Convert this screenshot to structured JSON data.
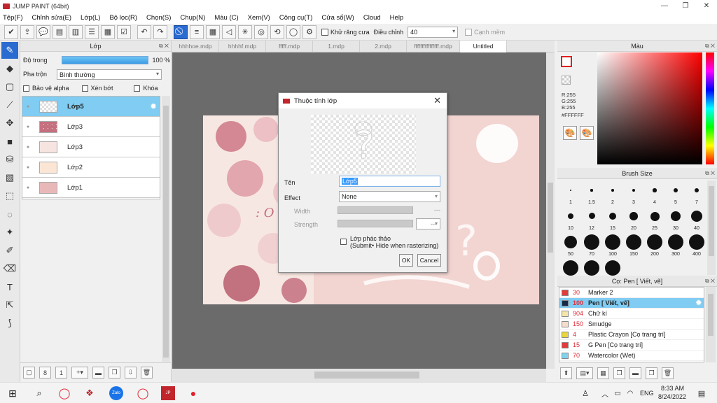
{
  "window": {
    "title": "JUMP PAINT (64bit)",
    "minimize": "—",
    "maximize": "❐",
    "close": "✕"
  },
  "menu": [
    "Tệp(F)",
    "Chỉnh sửa(E)",
    "Lớp(L)",
    "Bộ lọc(R)",
    "Chọn(S)",
    "Chụp(N)",
    "Màu (C)",
    "Xem(V)",
    "Công cụ(T)",
    "Cửa sổ(W)",
    "Cloud",
    "Help"
  ],
  "toolbar": {
    "antialias_label": "Khử răng cưa",
    "adjust_label": "Điều chỉnh",
    "adjust_value": "40",
    "sharp_label": "Cạnh mềm"
  },
  "layer_panel": {
    "title": "Lớp",
    "opacity_label": "Độ trong",
    "opacity_value": "100 %",
    "opacity_fraction": 1.0,
    "blend_label": "Pha trộn",
    "blend_value": "Bình thường",
    "protect_alpha": "Bảo vệ alpha",
    "clip": "Xén bớt",
    "lock": "Khóa",
    "layers": [
      {
        "name": "Lớp5",
        "selected": true
      },
      {
        "name": "Lớp3",
        "selected": false
      },
      {
        "name": "Lớp3",
        "selected": false
      },
      {
        "name": "Lớp2",
        "selected": false
      },
      {
        "name": "Lớp1",
        "selected": false
      }
    ]
  },
  "tabs": [
    "hhhhoe.mdp",
    "hhhhf.mdp",
    "fffff.mdp",
    "1.mdp",
    "2.mdp",
    "ffffffffffffffff.mdp",
    "Untitled"
  ],
  "active_tab": 6,
  "dialog": {
    "title": "Thuộc tính lớp",
    "name_label": "Tên",
    "name_value": "Lớp5",
    "effect_label": "Effect",
    "effect_value": "None",
    "width_label": "Width",
    "width_value": "---",
    "strength_label": "Strength",
    "strength_value": "---",
    "sketch_label": "Lớp phác thảo",
    "sketch_sub": "(Submit• Hide when rasterizing)",
    "ok": "OK",
    "cancel": "Cancel"
  },
  "color_panel": {
    "title": "Màu",
    "r": "R:255",
    "g": "G:255",
    "b": "B:255",
    "hex": "#FFFFFF"
  },
  "brush_panel": {
    "title": "Brush Size",
    "sizes": [
      "1",
      "1.5",
      "2",
      "3",
      "4",
      "5",
      "7",
      "10",
      "12",
      "15",
      "20",
      "25",
      "30",
      "40",
      "50",
      "70",
      "100",
      "150",
      "200",
      "300",
      "400",
      "",
      "",
      ""
    ]
  },
  "tool_panel": {
    "title": "Cọ: Pen [ Viết, vẽ]",
    "items": [
      {
        "num": "30",
        "name": "Marker 2",
        "color": "#e53a3a",
        "selected": false
      },
      {
        "num": "100",
        "name": "Pen [ Viết, vẽ]",
        "color": "#1b2a44",
        "selected": true
      },
      {
        "num": "904",
        "name": "Chữ kí",
        "color": "#f3e6a8",
        "selected": false
      },
      {
        "num": "150",
        "name": "Smudge",
        "color": "#f5dccc",
        "selected": false
      },
      {
        "num": "4",
        "name": "Plastic Crayon [Cọ trang trí]",
        "color": "#e8d63a",
        "selected": false
      },
      {
        "num": "15",
        "name": "G Pen [Cọ trang trí]",
        "color": "#e53a3a",
        "selected": false
      },
      {
        "num": "70",
        "name": "Watercolor (Wet)",
        "color": "#7fd3ef",
        "selected": false
      }
    ]
  },
  "taskbar": {
    "time": "8:33 AM",
    "date": "8/24/2022",
    "lang": "ENG"
  }
}
